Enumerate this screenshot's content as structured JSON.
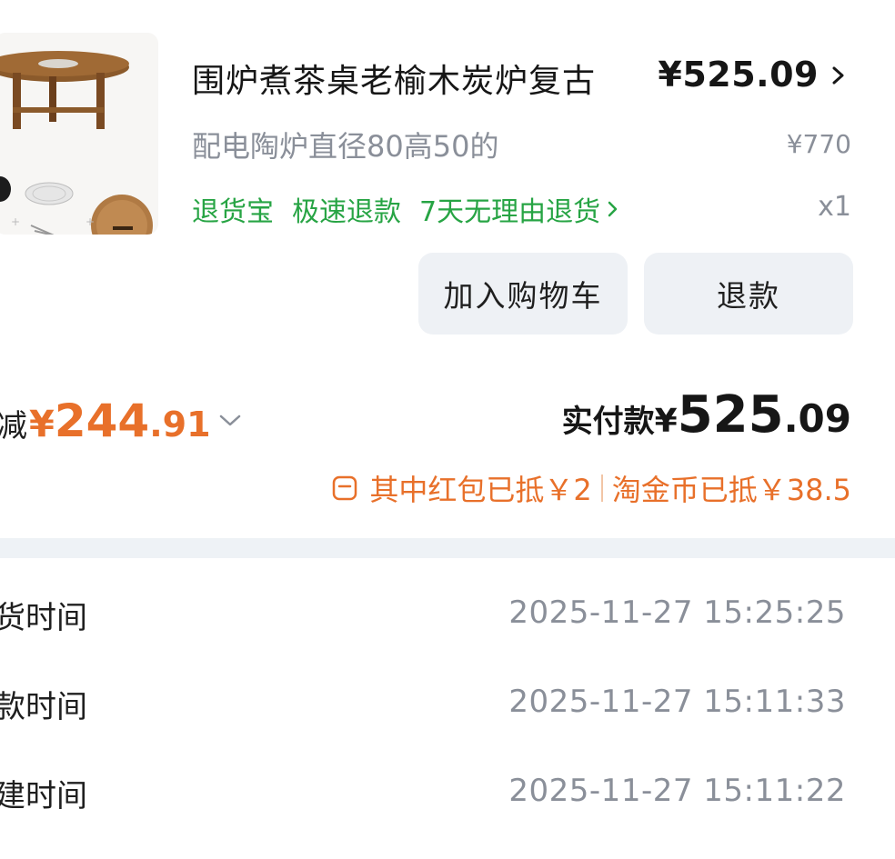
{
  "product": {
    "title": "围炉煮茶桌老榆木炭炉复古",
    "price": "¥525.09",
    "spec": "配电陶炉直径80高50的",
    "original_price": "¥770",
    "tags": [
      "退货宝",
      "极速退款",
      "7天无理由退货"
    ],
    "quantity": "x1"
  },
  "actions": {
    "add_to_cart": "加入购物车",
    "refund": "退款"
  },
  "discount": {
    "label": "减",
    "yen": "¥",
    "amount_int": "244",
    "amount_dec": ".91"
  },
  "paid": {
    "label": "实付款",
    "yen": "¥",
    "amount_int": "525",
    "amount_dec": ".09"
  },
  "subsidy": {
    "red_packet": "其中红包已抵￥2",
    "coins": "淘金币已抵￥38.5"
  },
  "timeline": [
    {
      "label": "货时间",
      "value": "2025-11-27 15:25:25"
    },
    {
      "label": "款时间",
      "value": "2025-11-27 15:11:33"
    },
    {
      "label": "建时间",
      "value": "2025-11-27 15:11:22"
    }
  ],
  "colors": {
    "accent_orange": "#e8702a",
    "tag_green": "#27a444",
    "muted_gray": "#8a8f99",
    "button_bg": "#eef1f5"
  },
  "icons": {
    "price_chevron": "chevron-right-icon",
    "tag_chevron": "chevron-right-icon",
    "discount_toggle": "chevron-down-icon",
    "subsidy": "wallet-icon"
  }
}
